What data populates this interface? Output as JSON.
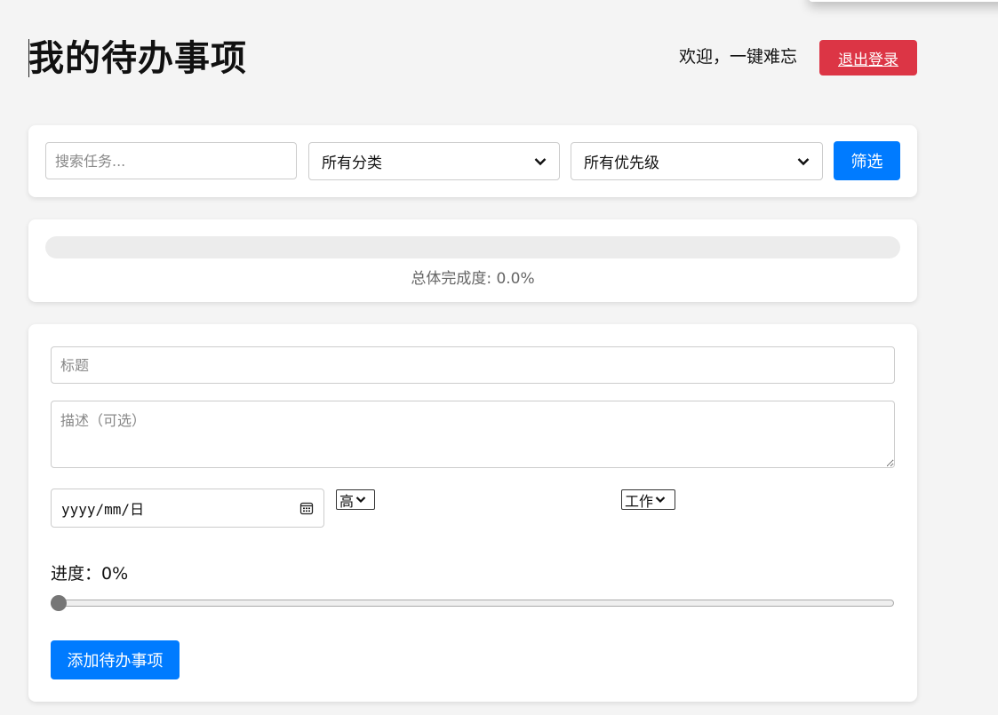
{
  "header": {
    "title": "我的待办事项",
    "welcome": "欢迎，一键难忘",
    "logout_label": "退出登录"
  },
  "filters": {
    "search_placeholder": "搜索任务...",
    "category_selected": "所有分类",
    "priority_selected": "所有优先级",
    "filter_label": "筛选"
  },
  "progress": {
    "completion_fraction": 0.0,
    "completion_text": "总体完成度: 0.0%"
  },
  "form": {
    "title_placeholder": "标题",
    "description_placeholder": "描述（可选）",
    "date_placeholder": "yyyy/mm/日",
    "priority_selected": "高",
    "category_selected": "工作",
    "progress_label": "进度：0%",
    "progress_value": 0,
    "add_label": "添加待办事项"
  },
  "colors": {
    "primary": "#007bff",
    "danger": "#dc3545",
    "background": "#f4f4f4"
  }
}
